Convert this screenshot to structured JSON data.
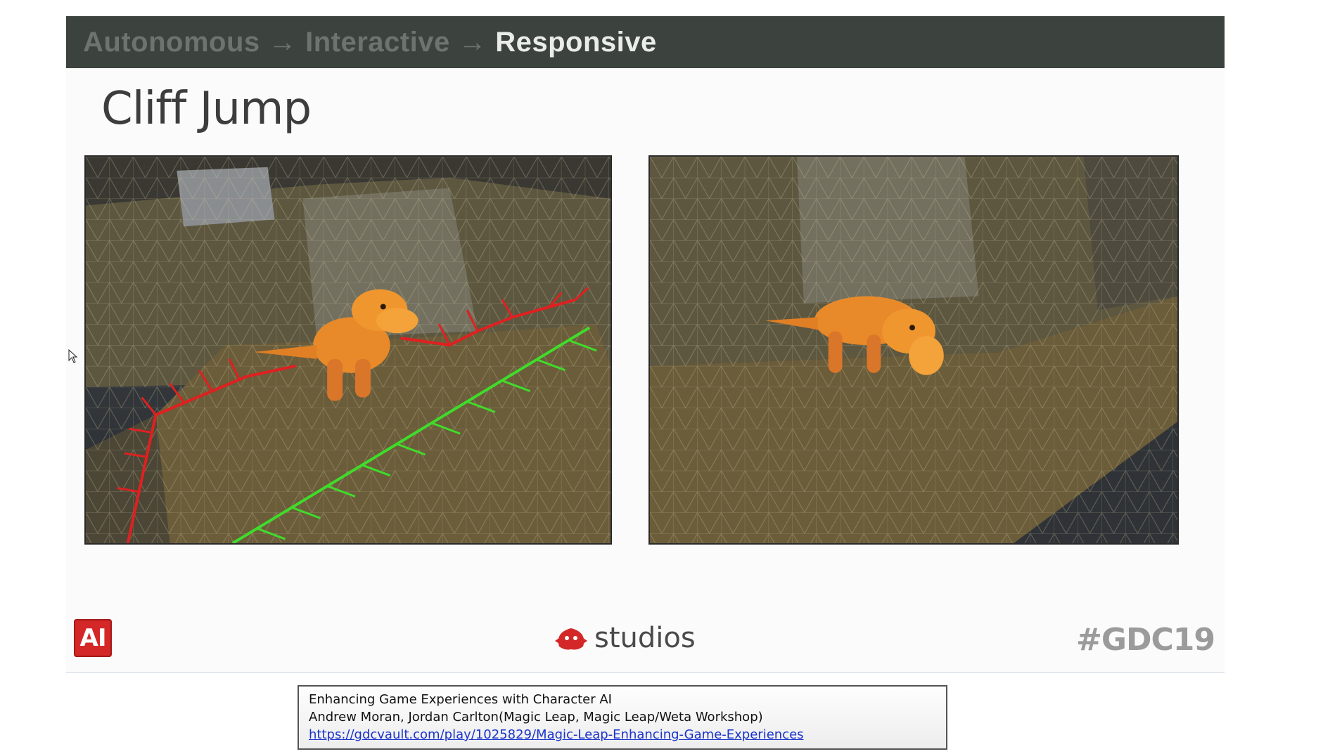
{
  "header": {
    "crumb_1": "Autonomous",
    "arrow_1": "→",
    "crumb_2": "Interactive",
    "arrow_2": "→",
    "crumb_3": "Responsive"
  },
  "slide": {
    "title": "Cliff Jump"
  },
  "footer": {
    "ai_logo_text": "AI",
    "studios_text": "studios",
    "hashtag": "#GDC19"
  },
  "info": {
    "line_1": "Enhancing Game Experiences with Character AI",
    "line_2": "Andrew Moran, Jordan Carlton(Magic Leap, Magic Leap/Weta Workshop)",
    "link": "https://gdcvault.com/play/1025829/Magic-Leap-Enhancing-Game-Experiences"
  },
  "colors": {
    "header_bg": "#3c423d",
    "ai_red": "#d42727",
    "edge_red": "#e02020",
    "edge_green": "#3fdc2a",
    "link_blue": "#1a33cc"
  }
}
